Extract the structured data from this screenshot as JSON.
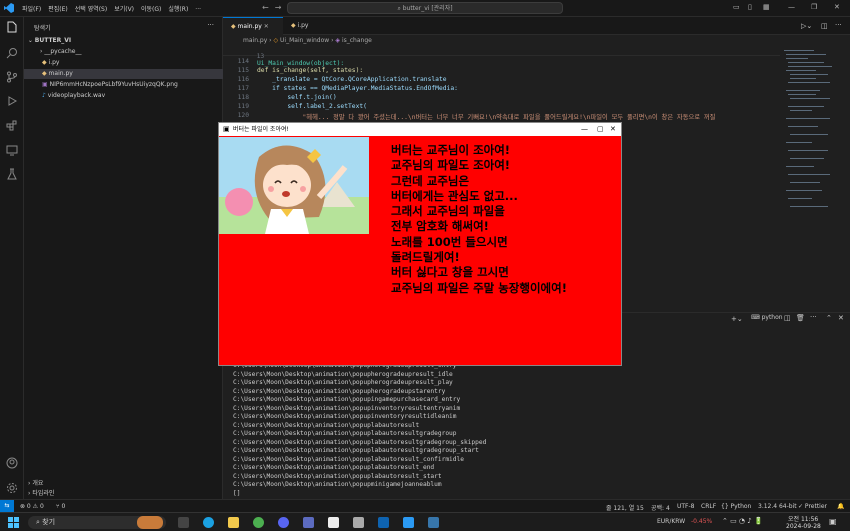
{
  "titlebar": {
    "menus": [
      "파일(F)",
      "편집(E)",
      "선택 영역(S)",
      "보기(V)",
      "이동(G)",
      "실행(R)",
      "..."
    ],
    "search": "butter_vi [관리자]"
  },
  "sidebar": {
    "header": "탐색기",
    "folder": "BUTTER_VI",
    "items": [
      "__pycache__",
      "i.py",
      "main.py",
      "NIP6mmHcNzpoePsLbf9YuvHsUiyzqQK.png",
      "videoplayback.wav"
    ],
    "outline": "개요",
    "timeline": "타임라인"
  },
  "tabs": [
    "main.py",
    "i.py"
  ],
  "breadcrumb": [
    "main.py",
    "Ui_Main_window",
    "is_change"
  ],
  "editor": {
    "sticky": {
      "no": "13",
      "text": "Ui_Main_window(object):"
    },
    "lines": [
      {
        "no": "114",
        "text": ""
      },
      {
        "no": "115",
        "text": "def is_change(self, states):"
      },
      {
        "no": "116",
        "text": "    _translate = QtCore.QCoreApplication.translate"
      },
      {
        "no": "117",
        "text": "    if states == QMediaPlayer.MediaStatus.EndOfMedia:"
      },
      {
        "no": "118",
        "text": "        self.t.join()"
      },
      {
        "no": "119",
        "text": "        self.label_2.setText("
      },
      {
        "no": "120",
        "text": "            \"헤헤... 정말 다 봤어 주셨는데...\\n버터는 너무 너무 기뻐요!\\n약속대로 파일을 풀어드릴게요!\\n파일이 모두 풀리면\\n이 창은 자동으로 꺼질"
      }
    ]
  },
  "terminal": {
    "shell": "python",
    "lines": [
      "C:\\Users\\Moon\\Desktop\\animation\\popupherogradeupresult_entry",
      "C:\\Users\\Moon\\Desktop\\animation\\popupherogradeupresult_idle",
      "C:\\Users\\Moon\\Desktop\\animation\\popupherogradeupresult_play",
      "C:\\Users\\Moon\\Desktop\\animation\\popupherogradeupstarentry",
      "C:\\Users\\Moon\\Desktop\\animation\\popupingamepurchasecard_entry",
      "C:\\Users\\Moon\\Desktop\\animation\\popupinventoryresultentryanim",
      "C:\\Users\\Moon\\Desktop\\animation\\popupinventoryresultidleanim",
      "C:\\Users\\Moon\\Desktop\\animation\\popuplabautoresult",
      "C:\\Users\\Moon\\Desktop\\animation\\popuplabautoresultgradegroup",
      "C:\\Users\\Moon\\Desktop\\animation\\popuplabautoresultgradegroup_skipped",
      "C:\\Users\\Moon\\Desktop\\animation\\popuplabautoresultgradegroup_start",
      "C:\\Users\\Moon\\Desktop\\animation\\popuplabautoresult_confirmidle",
      "C:\\Users\\Moon\\Desktop\\animation\\popuplabautoresult_end",
      "C:\\Users\\Moon\\Desktop\\animation\\popuplabautoresult_start",
      "C:\\Users\\Moon\\Desktop\\animation\\popupminigamejoanneablum",
      "[]"
    ]
  },
  "status": {
    "errors": "⊗ 0 ⚠ 0",
    "ports": "⑂ 0",
    "position": "줄 121, 열 15",
    "spaces": "공백: 4",
    "encoding": "UTF-8",
    "eol": "CRLF",
    "lang": "{} Python",
    "interpreter": "3.12.4 64-bit",
    "prettier": "✓ Prettier"
  },
  "taskbar": {
    "search": "찾기",
    "currency": "EUR/KRW",
    "change": "-0.45%",
    "time": "오전 11:56",
    "date": "2024-09-28"
  },
  "popup": {
    "title": "버터는 파일이 조아여!",
    "lines": [
      "버터는 교주님이 조아여!",
      "교주님의 파일도 조아여!",
      "그런데 교주님은",
      "버터에게는 관심도 없고...",
      "그래서 교주님의 파일을",
      "전부 암호화 해써여!",
      "노래를 100번 들으시면",
      "돌려드릴게여!",
      "버터 싫다고 창을 끄시면",
      "교주님의 파일은 주말 농장행이에여!"
    ]
  },
  "colors": {
    "accent": "#0078d4",
    "popup_bg": "#ff0000"
  }
}
